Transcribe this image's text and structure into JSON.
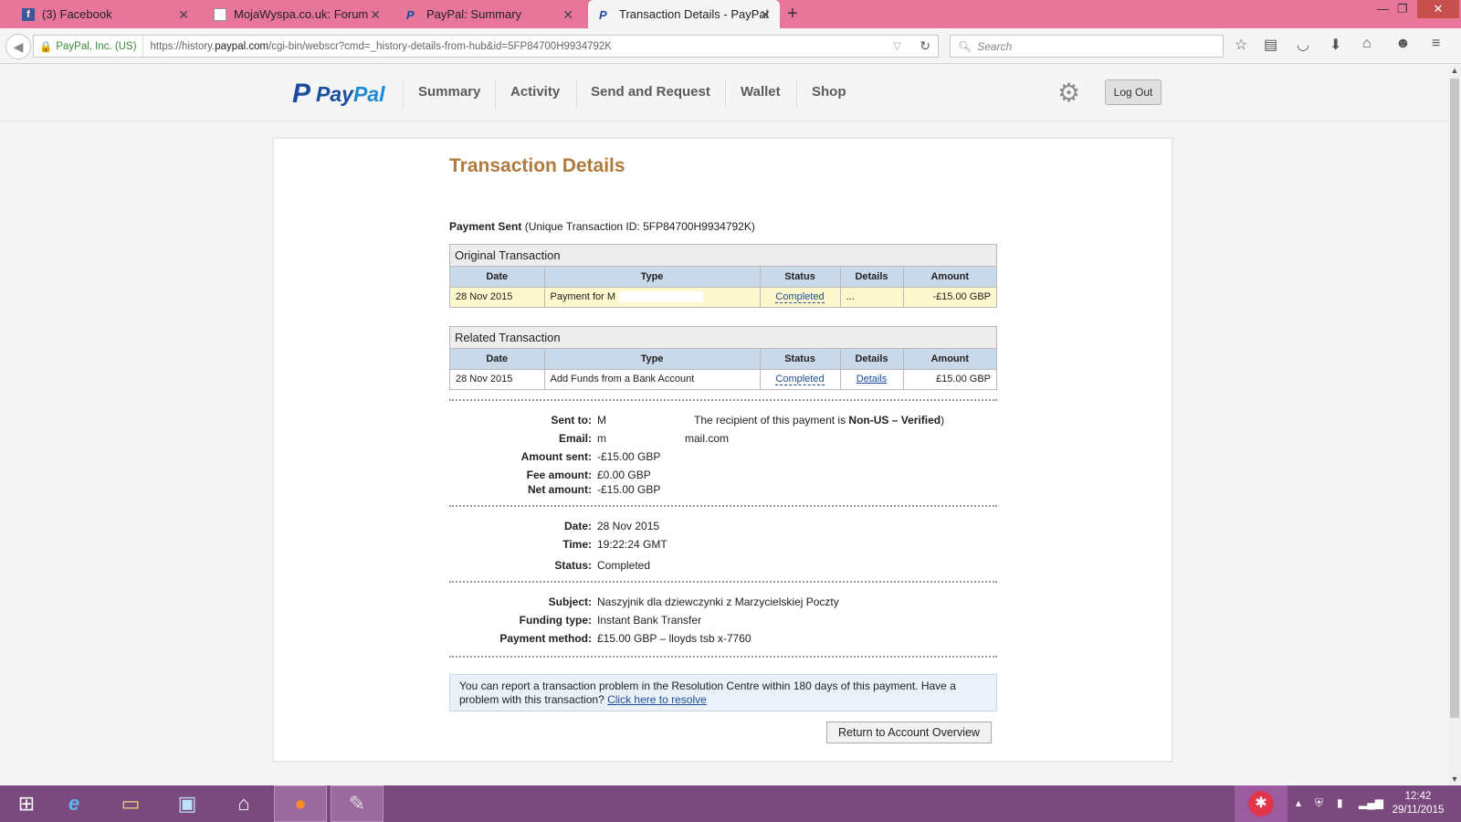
{
  "browser": {
    "tabs": [
      {
        "title": "(3) Facebook",
        "icon": "facebook-icon"
      },
      {
        "title": "MojaWyspa.co.uk: Forum",
        "icon": "mojawyspa-icon"
      },
      {
        "title": "PayPal: Summary",
        "icon": "paypal-icon"
      },
      {
        "title": "Transaction Details - PayPal",
        "icon": "paypal-icon"
      }
    ],
    "new_tab": "+",
    "ssl_label": "PayPal, Inc. (US)",
    "url_prefix": "https://history.",
    "url_domain": "paypal.com",
    "url_suffix": "/cgi-bin/webscr?cmd=_history-details-from-hub&id=5FP84700H9934792K",
    "search_placeholder": "Search"
  },
  "paypal": {
    "nav": [
      "Summary",
      "Activity",
      "Send and Request",
      "Wallet",
      "Shop"
    ],
    "logout": "Log Out"
  },
  "page": {
    "title": "Transaction Details",
    "payment_sent": "Payment Sent",
    "transaction_id": "(Unique Transaction ID: 5FP84700H9934792K)",
    "original": {
      "caption": "Original Transaction",
      "headers": [
        "Date",
        "Type",
        "Status",
        "Details",
        "Amount"
      ],
      "row": {
        "date": "28 Nov 2015",
        "type": "Payment for M",
        "status": "Completed",
        "details": "...",
        "amount": "-£15.00 GBP"
      }
    },
    "related": {
      "caption": "Related Transaction",
      "headers": [
        "Date",
        "Type",
        "Status",
        "Details",
        "Amount"
      ],
      "row": {
        "date": "28 Nov 2015",
        "type": "Add Funds from a Bank Account",
        "status": "Completed",
        "details": "Details",
        "amount": "£15.00 GBP"
      }
    },
    "sent_to_label": "Sent to:",
    "sent_to_value": "M",
    "recipient_prefix": "The recipient of this payment is ",
    "recipient_status": "Non-US – Verified",
    "email_label": "Email:",
    "email_start": "m",
    "email_end": "mail.com",
    "amount_sent_label": "Amount sent:",
    "amount_sent": "-£15.00 GBP",
    "fee_label": "Fee amount:",
    "fee": "£0.00 GBP",
    "net_label": "Net amount:",
    "net": "-£15.00 GBP",
    "date_label": "Date:",
    "date": "28 Nov 2015",
    "time_label": "Time:",
    "time": "19:22:24 GMT",
    "status_label": "Status:",
    "status": "Completed",
    "subject_label": "Subject:",
    "subject": "Naszyjnik dla dziewczynki z Marzycielskiej Poczty",
    "funding_label": "Funding type:",
    "funding": "Instant Bank Transfer",
    "method_label": "Payment method:",
    "method": "£15.00 GBP – lloyds tsb x-7760",
    "notice_text": "You can report a transaction problem in the Resolution Centre within 180 days of this payment. Have a problem with this transaction? ",
    "notice_link": "Click here to resolve",
    "return_button": "Return to Account Overview"
  },
  "taskbar": {
    "clock_time": "12:42",
    "clock_date": "29/11/2015"
  }
}
